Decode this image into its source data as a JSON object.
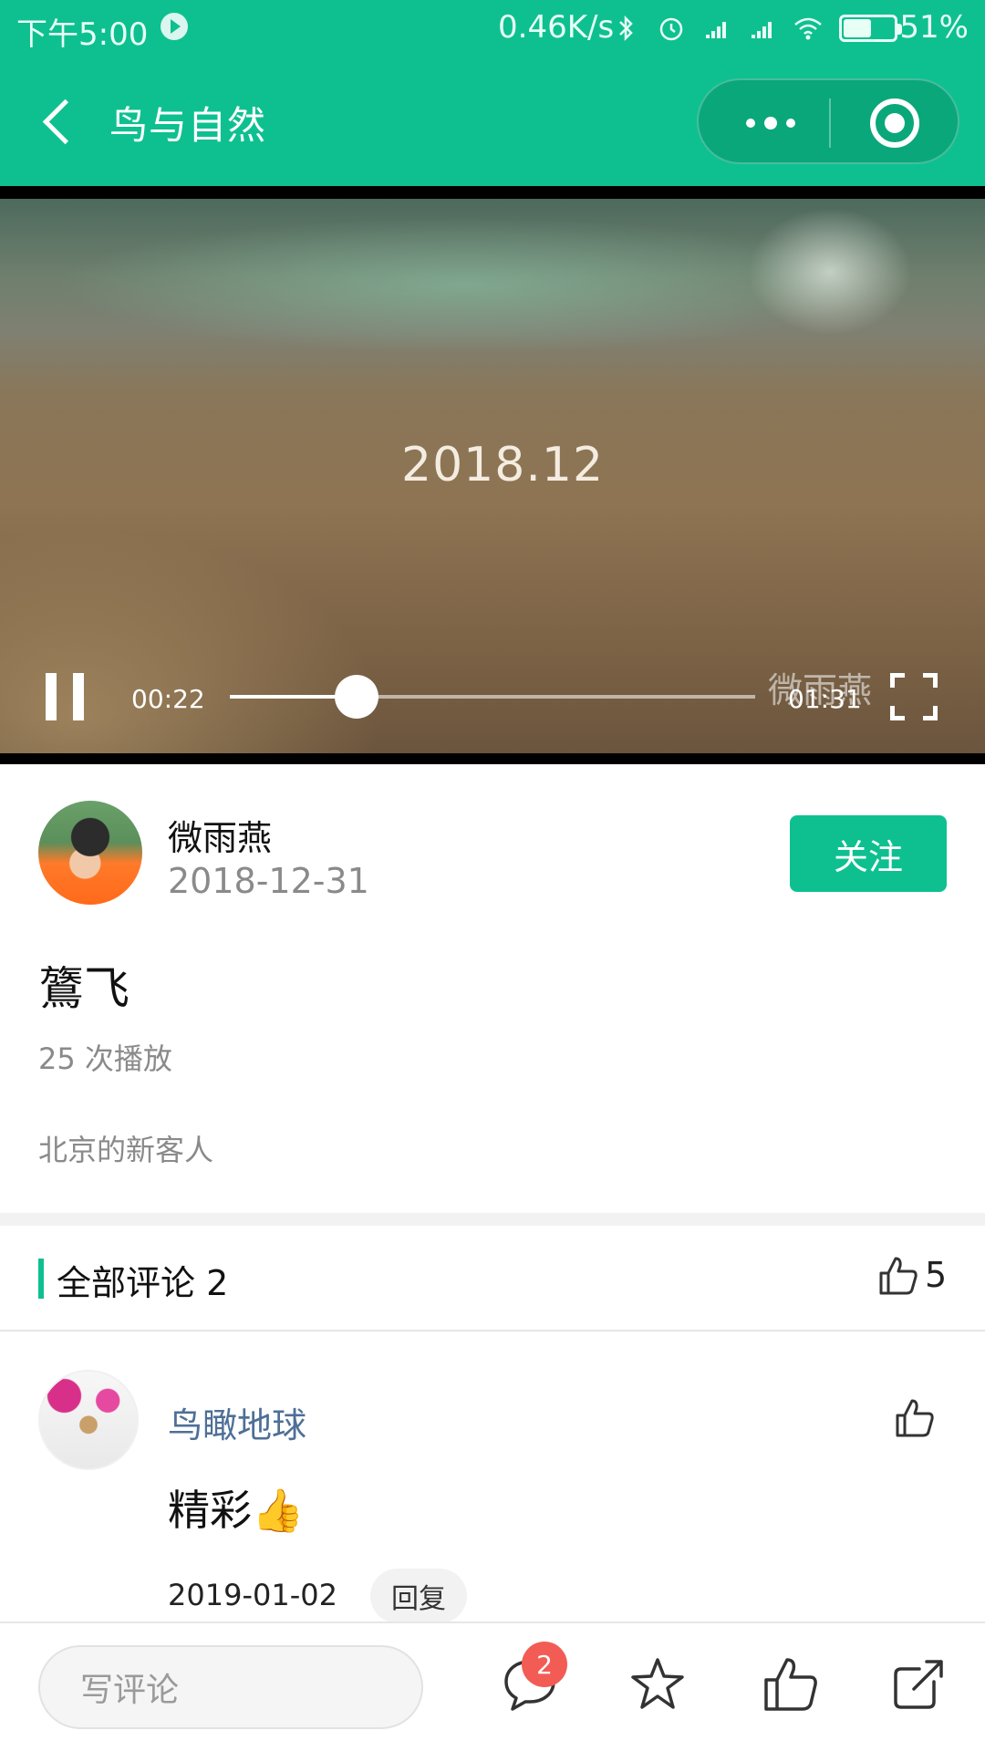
{
  "status_bar": {
    "time": "下午5:00",
    "network_speed": "0.46K/s",
    "battery": "51%"
  },
  "nav": {
    "title": "鸟与自然"
  },
  "video": {
    "overlay_text": "2018.12",
    "watermark": "微雨燕",
    "current_time": "00:22",
    "duration": "01:31",
    "progress": 0.242
  },
  "author": {
    "name": "微雨燕",
    "date": "2018-12-31",
    "follow_label": "关注"
  },
  "post": {
    "title": "鷟飞",
    "play_count": "25 次播放",
    "description": "北京的新客人"
  },
  "comments_section": {
    "header": "全部评论 2",
    "like_count": "5"
  },
  "comments": [
    {
      "name": "鸟瞰地球",
      "text": "精彩👍",
      "date": "2019-01-02",
      "reply_label": "回复"
    }
  ],
  "bottom_bar": {
    "input_placeholder": "写评论",
    "comment_badge": "2"
  },
  "colors": {
    "accent": "#0ec090",
    "badge": "#f25c54",
    "commenter_name": "#4e6f97"
  },
  "icons": [
    "play-store-icon",
    "bluetooth-icon",
    "alarm-icon",
    "signal-icon",
    "wifi-icon",
    "battery-icon",
    "back-icon",
    "more-icon",
    "close-miniprogram-icon",
    "pause-icon",
    "fullscreen-icon",
    "thumbs-up-icon",
    "comment-icon",
    "star-icon",
    "share-icon"
  ]
}
